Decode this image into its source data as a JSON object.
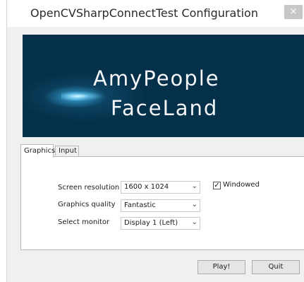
{
  "window": {
    "title": "OpenCVSharpConnectTest Configuration",
    "close_icon": "close-icon",
    "close_glyph": "×"
  },
  "banner": {
    "line1": "AmyPeople",
    "line2": "FaceLand"
  },
  "tabs": [
    {
      "label": "Graphics",
      "active": true
    },
    {
      "label": "Input",
      "active": false
    }
  ],
  "graphics": {
    "screen_resolution": {
      "label": "Screen resolution",
      "value": "1600 x 1024"
    },
    "graphics_quality": {
      "label": "Graphics quality",
      "value": "Fantastic"
    },
    "select_monitor": {
      "label": "Select monitor",
      "value": "Display 1 (Left)"
    },
    "windowed": {
      "label": "Windowed",
      "checked": true,
      "check_glyph": "✓"
    },
    "dropdown_glyph": "⌄"
  },
  "buttons": {
    "play": "Play!",
    "quit": "Quit"
  },
  "colors": {
    "banner_bg": "#053049",
    "banner_glow": "#8ce1ff"
  }
}
